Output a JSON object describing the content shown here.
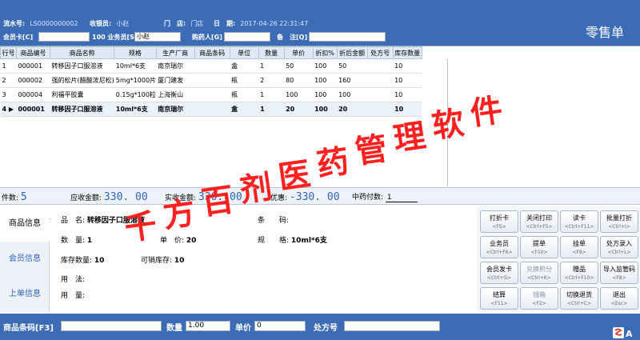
{
  "header": {
    "serial_label": "流水号:",
    "serial_value": "LS0000000002",
    "cashier_label": "收银员:",
    "cashier_value": "小赵",
    "store_label": "门　店:",
    "store_value": "门店",
    "date_label": "日　期:",
    "date_value": "2017-04-26 22:31:47",
    "member_label": "会员卡[C]",
    "salesman_label": "100 业务员[S]",
    "salesman_value": "小赵",
    "buyer_label": "购药人[G]",
    "note_label": "备　注[Q]",
    "title": "零售单"
  },
  "table": {
    "columns": [
      "行号",
      "商品编号",
      "商品名称",
      "规格",
      "生产厂商",
      "商品条码",
      "单位",
      "数量",
      "单价",
      "折扣%",
      "折后金额",
      "处方号",
      "库存数量"
    ],
    "rows": [
      [
        "1",
        "000001",
        "转移因子口服溶液",
        "10ml*6支",
        "南京瑞尔",
        "",
        "盒",
        "1",
        "50",
        "100",
        "50",
        "",
        "10"
      ],
      [
        "2",
        "000002",
        "强的松片(醋酸泼尼松)",
        "5mg*1000片",
        "厦门建发",
        "",
        "瓶",
        "2",
        "80",
        "100",
        "160",
        "",
        "10"
      ],
      [
        "3",
        "000004",
        "利福平胶囊",
        "0.15g*100粒",
        "上海衡山",
        "",
        "瓶",
        "1",
        "100",
        "100",
        "100",
        "",
        "10"
      ],
      [
        "4",
        "000001",
        "转移因子口服溶液",
        "10ml*6支",
        "南京瑞尔",
        "",
        "盒",
        "1",
        "20",
        "100",
        "20",
        "",
        "10"
      ]
    ],
    "current_marker": "▶",
    "sum_label": "合计",
    "sum_qty": "5",
    "sum_amount": "330",
    "sum_stock": "40"
  },
  "amounts": {
    "count_label": "件数:",
    "count_value": "5",
    "receivable_label": "应收金额:",
    "receivable_value": "330. 00",
    "received_label": "实收金额:",
    "received_value": "330. 00",
    "discount_label": "优惠:",
    "discount_value": "-330. 00",
    "herb_label": "中药付数:",
    "herb_value": "1"
  },
  "side_tabs": [
    "商品信息",
    "会员信息",
    "上单信息"
  ],
  "detail": {
    "name_label": "品　名:",
    "name_value": "转移因子口服溶液",
    "barcode_label": "条　　码:",
    "qty_label": "数　量:",
    "qty_value": "1",
    "price_label": "单　价:",
    "price_value": "20",
    "spec_label": "规　　格:",
    "spec_value": "10ml*6支",
    "stock_label": "库存数量:",
    "stock_value": "10",
    "sellable_label": "可销库存:",
    "sellable_value": "10",
    "usage_label": "用　法:",
    "dosage_label": "用　量:"
  },
  "buttons": [
    {
      "label": "打折卡",
      "key": "<F5>",
      "disabled": false
    },
    {
      "label": "关闭打印",
      "key": "<Ctrl+F5>",
      "disabled": false
    },
    {
      "label": "读卡",
      "key": "<Ctrl+F11>",
      "disabled": false
    },
    {
      "label": "批量打折",
      "key": "<Ctrl+I>",
      "disabled": false
    },
    {
      "label": "业务员",
      "key": "<Ctrl+F6>",
      "disabled": false
    },
    {
      "label": "提单",
      "key": "<F10>",
      "disabled": false
    },
    {
      "label": "挂单",
      "key": "<F9>",
      "disabled": false
    },
    {
      "label": "处方录入",
      "key": "<Ctrl+L>",
      "disabled": false
    },
    {
      "label": "会员发卡",
      "key": "<Ctrl+G>",
      "disabled": false
    },
    {
      "label": "兑换积分",
      "key": "<Ctrl+K>",
      "disabled": true
    },
    {
      "label": "赠品",
      "key": "<Ctrl+F10>",
      "disabled": false
    },
    {
      "label": "导入监管码",
      "key": "<F8>",
      "disabled": false
    },
    {
      "label": "结算",
      "key": "<F11>",
      "disabled": false
    },
    {
      "label": "钱箱",
      "key": "<F2>",
      "disabled": true
    },
    {
      "label": "切换退货",
      "key": "<Ctrl+C>",
      "disabled": false
    },
    {
      "label": "退出",
      "key": "<Esc>",
      "disabled": false
    }
  ],
  "footer": {
    "barcode_label": "商品条码[F3]",
    "qty_label": "数量",
    "qty_value": "1.00",
    "price_label": "单价",
    "price_value": "0",
    "rx_label": "处方号"
  },
  "watermark": "千方百剂医药管理软件",
  "colors": {
    "brand": "#3b6cb5",
    "accent": "#2e63b8",
    "watermark": "#ff2020"
  }
}
